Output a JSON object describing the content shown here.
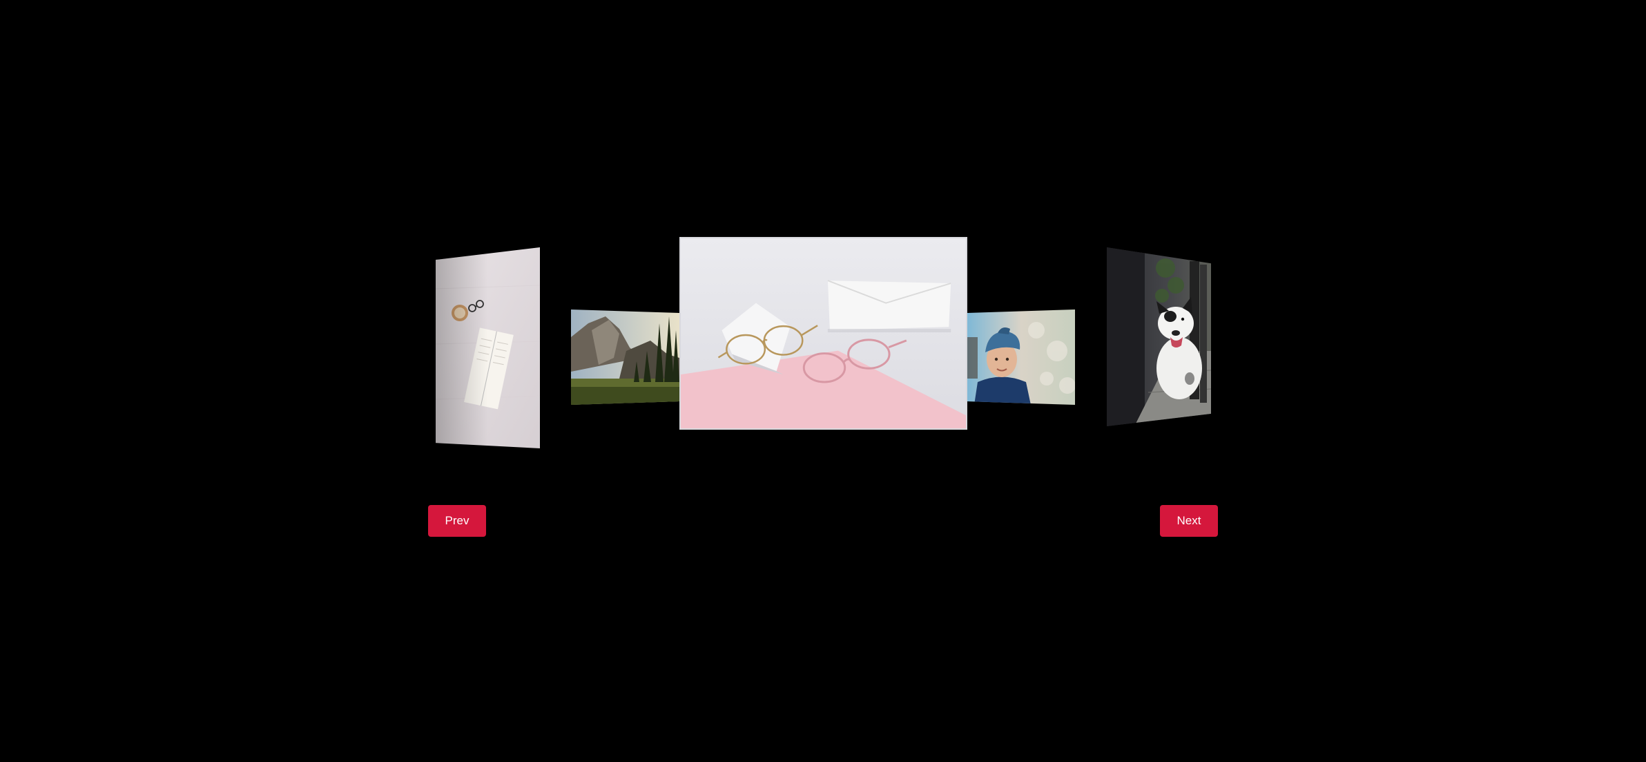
{
  "carousel": {
    "slides": [
      {
        "name": "book-coffee-photo"
      },
      {
        "name": "mountain-landscape-photo"
      },
      {
        "name": "eyeglasses-photo",
        "active": true
      },
      {
        "name": "boy-with-cap-photo"
      },
      {
        "name": "dog-photo"
      }
    ],
    "prev_label": "Prev",
    "next_label": "Next"
  },
  "colors": {
    "background": "#000000",
    "button": "#d5173c",
    "button_text": "#ffffff"
  }
}
